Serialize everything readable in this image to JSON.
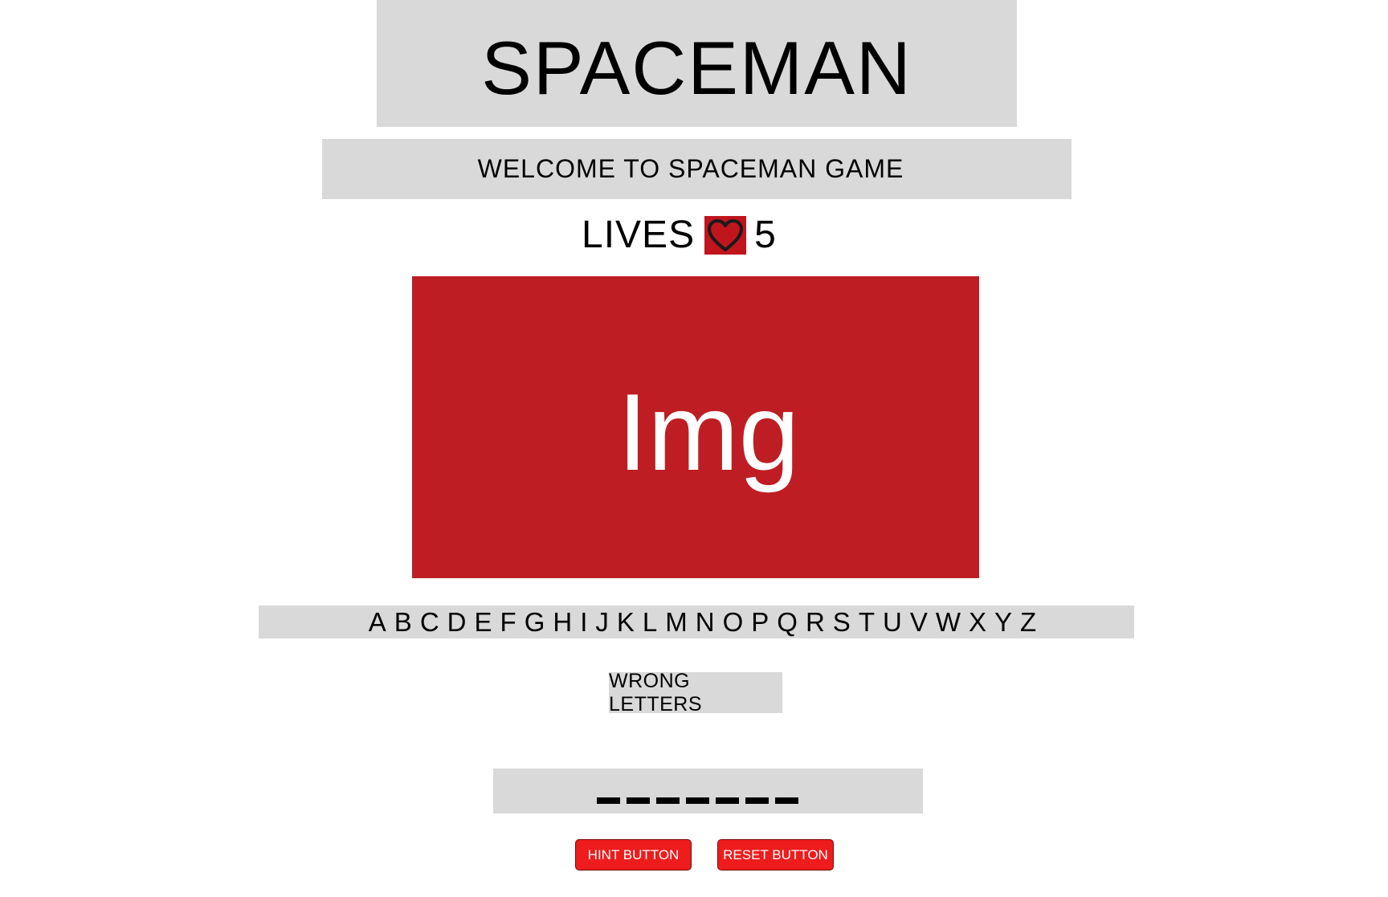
{
  "title": "SPACEMAN",
  "welcome": "WELCOME TO SPACEMAN GAME",
  "lives": {
    "label": "LIVES",
    "icon": "heart-icon",
    "count": "5"
  },
  "image": {
    "placeholder": "Img"
  },
  "alphabet": [
    "A",
    "B",
    "C",
    "D",
    "E",
    "F",
    "G",
    "H",
    "I",
    "J",
    "K",
    "L",
    "M",
    "N",
    "O",
    "P",
    "Q",
    "R",
    "S",
    "T",
    "U",
    "V",
    "W",
    "X",
    "Y",
    "Z"
  ],
  "wrong_letters": {
    "label": "WRONG LETTERS"
  },
  "word": {
    "blanks": 7
  },
  "buttons": {
    "hint": "HINT BUTTON",
    "reset": "RESET BUTTON"
  },
  "colors": {
    "panel": "#d9d9d9",
    "image_bg": "#be1e23",
    "heart_bg": "#c0151d",
    "button_bg": "#ee1c1c"
  }
}
